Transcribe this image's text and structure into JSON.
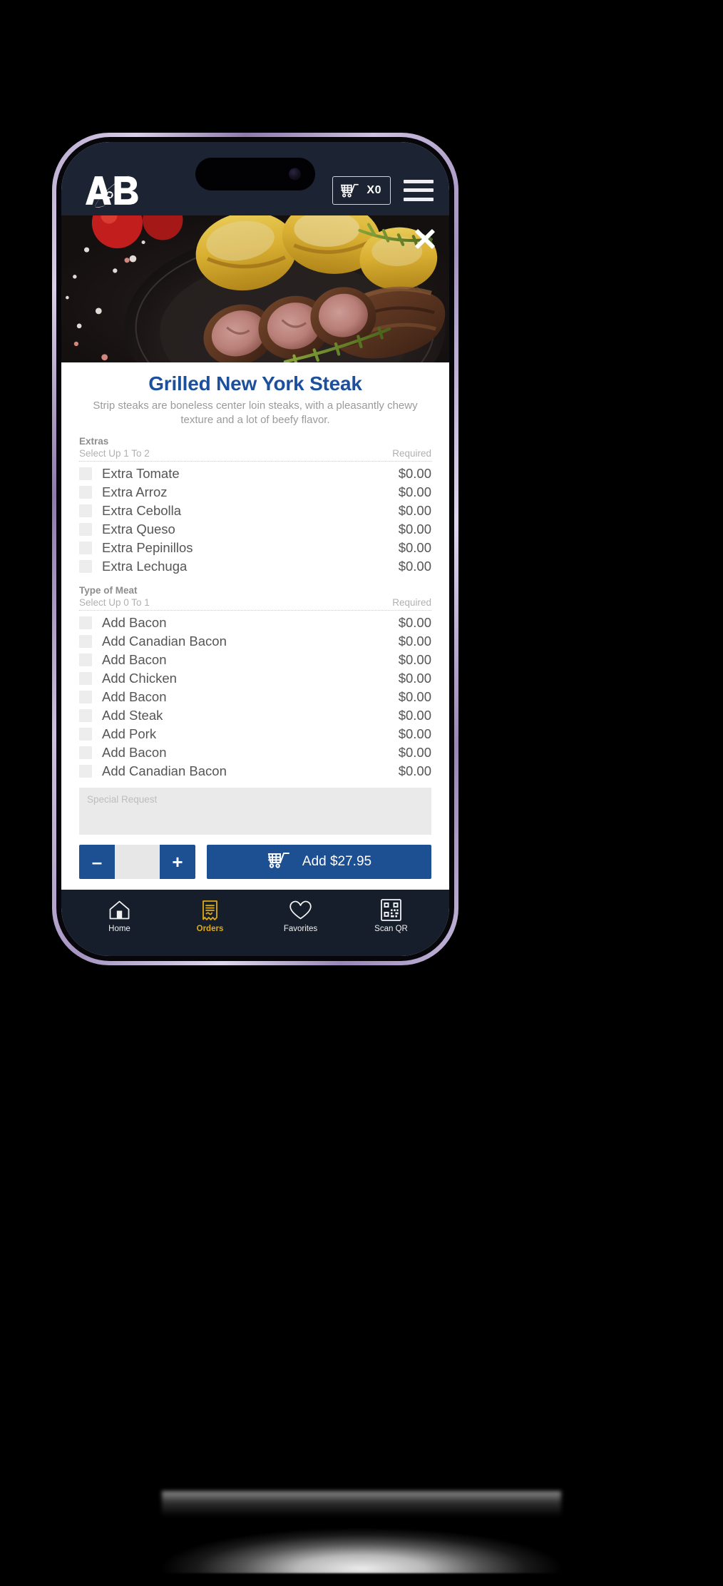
{
  "header": {
    "logo_alt": "A&B",
    "cart_icon": "shopping-cart-icon",
    "cart_count": "X0",
    "menu_icon": "hamburger-menu-icon"
  },
  "hero": {
    "close_icon": "close-icon",
    "image_alt": "Grilled steak slices with roasted potatoes on a dark plate"
  },
  "item": {
    "title": "Grilled New York Steak",
    "description": "Strip steaks are boneless center loin steaks, with a pleasantly chewy texture and a lot of beefy flavor."
  },
  "groups": [
    {
      "title": "Extras",
      "select_rule": "Select Up 1 To 2",
      "requirement": "Required",
      "options": [
        {
          "label": "Extra Tomate",
          "price": "$0.00",
          "checked": false
        },
        {
          "label": "Extra Arroz",
          "price": "$0.00",
          "checked": false
        },
        {
          "label": "Extra Cebolla",
          "price": "$0.00",
          "checked": false
        },
        {
          "label": "Extra Queso",
          "price": "$0.00",
          "checked": false
        },
        {
          "label": "Extra Pepinillos",
          "price": "$0.00",
          "checked": false
        },
        {
          "label": "Extra Lechuga",
          "price": "$0.00",
          "checked": false
        }
      ]
    },
    {
      "title": "Type of Meat",
      "select_rule": "Select Up 0 To 1",
      "requirement": "Required",
      "options": [
        {
          "label": "Add Bacon",
          "price": "$0.00",
          "checked": false
        },
        {
          "label": "Add Canadian Bacon",
          "price": "$0.00",
          "checked": false
        },
        {
          "label": "Add Bacon",
          "price": "$0.00",
          "checked": false
        },
        {
          "label": "Add Chicken",
          "price": "$0.00",
          "checked": false
        },
        {
          "label": "Add Bacon",
          "price": "$0.00",
          "checked": false
        },
        {
          "label": "Add Steak",
          "price": "$0.00",
          "checked": false
        },
        {
          "label": "Add Pork",
          "price": "$0.00",
          "checked": false
        },
        {
          "label": "Add Bacon",
          "price": "$0.00",
          "checked": false
        },
        {
          "label": "Add Canadian Bacon",
          "price": "$0.00",
          "checked": false
        }
      ]
    }
  ],
  "special_request": {
    "placeholder": "Special Request",
    "value": ""
  },
  "actions": {
    "decrement_label": "–",
    "increment_label": "+",
    "quantity_value": "",
    "add_label": "Add $27.95",
    "add_icon": "shopping-cart-icon"
  },
  "tabbar": {
    "items": [
      {
        "label": "Home",
        "icon": "home-icon",
        "active": false
      },
      {
        "label": "Orders",
        "icon": "receipt-icon",
        "active": true
      },
      {
        "label": "Favorites",
        "icon": "heart-icon",
        "active": false
      },
      {
        "label": "Scan QR",
        "icon": "qr-code-icon",
        "active": false
      }
    ]
  },
  "colors": {
    "brand_blue": "#1d4f93",
    "title_blue": "#1c4f9c",
    "header_navy": "#1c2333",
    "tabbar_navy": "#161d2b",
    "active_gold": "#e0aa10",
    "checkbox_gray": "#ededed"
  }
}
